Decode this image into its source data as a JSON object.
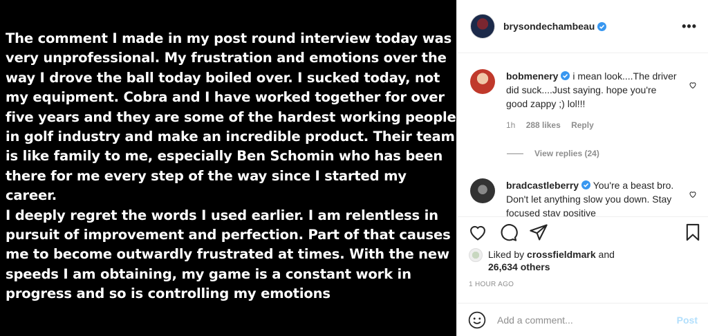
{
  "post_image": {
    "text": "The comment I made in my post round interview today was\nvery unprofessional. My frustration and emotions over the\nway I drove the ball today boiled over. I sucked today, not\nmy equipment. Cobra and I have worked together for over\nfive years and they are some of the hardest working people\nin golf industry and make an incredible product. Their team\nis like family to me, especially Ben Schomin who has been\nthere for me every step of the way since I started my career.\nI deeply regret the words I used earlier. I am relentless in\npursuit of improvement and perfection. Part of that causes\nme to become outwardly frustrated at times. With the new\nspeeds I am obtaining, my game is a constant work in\nprogress and so is controlling my emotions"
  },
  "header": {
    "username": "brysondechambeau",
    "more_icon": "more-horizontal-icon",
    "more_label": "•••"
  },
  "comments": [
    {
      "username": "bobmenery",
      "text": "i mean look....The driver did suck....Just saying. hope you're good zappy ;) lol!!!",
      "time": "1h",
      "likes": "288 likes",
      "reply": "Reply",
      "view_replies": "View replies (24)"
    },
    {
      "username": "bradcastleberry",
      "text": "You're a beast bro. Don't let anything slow you down. Stay focused stay positive"
    }
  ],
  "likes": {
    "prefix": "Liked by ",
    "user": "crossfieldmark",
    "and": " and",
    "others": "26,634 others"
  },
  "time_ago": "1 HOUR AGO",
  "add_comment": {
    "placeholder": "Add a comment...",
    "post_label": "Post"
  },
  "colors": {
    "verified": "#3897f0",
    "post_disabled": "#b2dffc",
    "meta": "#8e8e8e",
    "text": "#262626"
  }
}
